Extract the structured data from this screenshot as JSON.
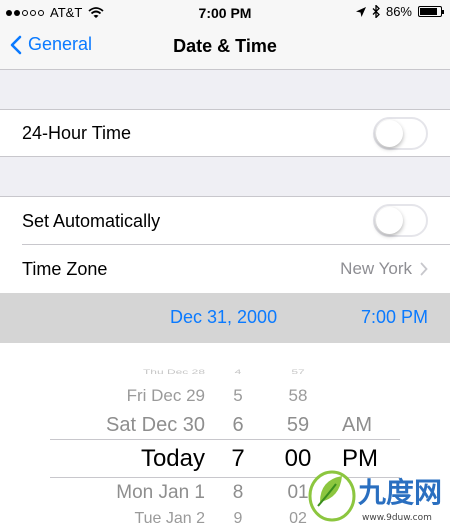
{
  "status_bar": {
    "carrier": "AT&T",
    "time": "7:00 PM",
    "battery": "86%",
    "battery_level": 0.86,
    "signal_bars_filled": 2,
    "signal_bars_total": 5
  },
  "nav": {
    "back_label": "General",
    "title": "Date & Time"
  },
  "settings": {
    "hour24": {
      "label": "24-Hour Time",
      "enabled": false
    },
    "set_automatically": {
      "label": "Set Automatically",
      "enabled": false
    },
    "time_zone": {
      "label": "Time Zone",
      "value": "New York"
    }
  },
  "datetime": {
    "date": "Dec 31, 2000",
    "time": "7:00 PM"
  },
  "picker": {
    "rows": [
      {
        "date": "Thu Dec 28",
        "hour": "4",
        "minute": "57",
        "ampm": ""
      },
      {
        "date": "Fri Dec 29",
        "hour": "5",
        "minute": "58",
        "ampm": ""
      },
      {
        "date": "Sat Dec 30",
        "hour": "6",
        "minute": "59",
        "ampm": "AM"
      },
      {
        "date": "Today",
        "hour": "7",
        "minute": "00",
        "ampm": "PM"
      },
      {
        "date": "Mon Jan 1",
        "hour": "8",
        "minute": "01",
        "ampm": ""
      },
      {
        "date": "Tue Jan 2",
        "hour": "9",
        "minute": "02",
        "ampm": ""
      }
    ]
  },
  "watermark": {
    "logo_text": "九度网",
    "url": "www.9duw.com"
  },
  "colors": {
    "accent": "#0a7aff",
    "secondary_text": "#8e8e93",
    "group_background": "#efeff4",
    "picker_header": "#d5d5d5"
  }
}
